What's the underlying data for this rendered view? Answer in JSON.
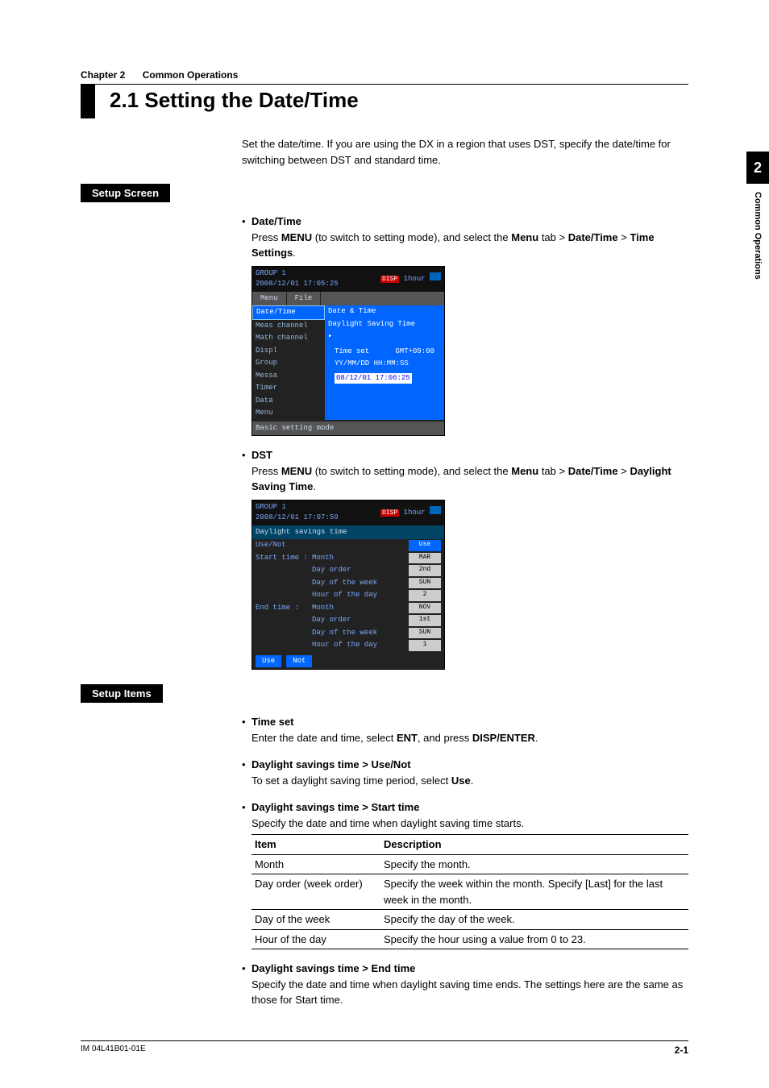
{
  "chapter": {
    "num": "Chapter 2",
    "name": "Common Operations"
  },
  "title": "2.1    Setting the Date/Time",
  "intro": "Set the date/time. If you are using the DX in a region that uses DST, specify the date/time for switching between DST and standard time.",
  "section_setup_screen": "Setup Screen",
  "datetime": {
    "head": "Date/Time",
    "line_a": "Press ",
    "menu": "MENU",
    "line_b": " (to switch to setting mode), and select the ",
    "menu2": "Menu",
    "line_c": " tab > ",
    "dt": "Date/Time",
    "line_d": " > ",
    "ts": "Time Settings",
    "period": "."
  },
  "dst": {
    "head": "DST",
    "line_a": "Press ",
    "menu": "MENU",
    "line_b": " (to switch to setting mode), and select the ",
    "menu2": "Menu",
    "line_c": " tab > ",
    "dt": "Date/Time",
    "line_d": " > ",
    "ts": "Daylight Saving Time",
    "period": "."
  },
  "ss1": {
    "group": "GROUP 1",
    "ts": "2008/12/01 17:05:25",
    "disp": "DISP",
    "hour": "1hour",
    "tab_menu": "Menu",
    "tab_file": "File",
    "l1": "Date/Time",
    "l2": "Meas channel",
    "l3": "Math channel",
    "l4": "Displ",
    "l5": "Group",
    "l6": "Messa",
    "l7": "Timer",
    "l8": "Data",
    "l9": "Menu",
    "r1": "Date & Time",
    "r2": "Daylight Saving Time",
    "p_head": "Time set",
    "p_gmt": "GMT+09:00",
    "p_fmt": "YY/MM/DD  HH:MM:SS",
    "p_val": "08/12/01 17:06:25",
    "bsm": "Basic setting mode"
  },
  "ss2": {
    "group": "GROUP 1",
    "ts": "2008/12/01 17:07:59",
    "disp": "DISP",
    "hour": "1hour",
    "title": "Daylight savings time",
    "usenot": "Use/Not",
    "use": "Use",
    "st": "Start time :",
    "et": "End time   :",
    "month": "Month",
    "dayorder": "Day order",
    "dow": "Day of the week",
    "hod": "Hour of the day",
    "v_mar": "MAR",
    "v_2nd": "2nd",
    "v_sun": "SUN",
    "v_2": "2",
    "v_nov": "NOV",
    "v_1st": "1st",
    "v_sun2": "SUN",
    "v_1": "1",
    "btn_use": "Use",
    "btn_not": "Not"
  },
  "section_setup_items": "Setup Items",
  "si_timeset": {
    "head": "Time set",
    "a": "Enter the date and time, select ",
    "ent": "ENT",
    "b": ", and press ",
    "de": "DISP/ENTER",
    "c": "."
  },
  "si_usenot": {
    "head": "Daylight savings time > Use/Not",
    "a": "To set a daylight saving time period, select ",
    "use": "Use",
    "b": "."
  },
  "si_start": {
    "head": "Daylight savings time > Start time",
    "a": "Specify the date and time when daylight saving time starts."
  },
  "table": {
    "h1": "Item",
    "h2": "Description",
    "r1c1": "Month",
    "r1c2": "Specify the month.",
    "r2c1": "Day order (week order)",
    "r2c2": "Specify the week within the month. Specify [Last] for the last week in the month.",
    "r3c1": "Day of the week",
    "r3c2": "Specify the day of the week.",
    "r4c1": "Hour of the day",
    "r4c2": "Specify the hour using a value from 0 to 23."
  },
  "si_end": {
    "head": "Daylight savings time > End time",
    "a": "Specify the date and time when daylight saving time ends. The settings here are the same as those for Start time."
  },
  "sidetab": {
    "num": "2",
    "text": "Common Operations"
  },
  "footer": {
    "left": "IM 04L41B01-01E",
    "right": "2-1"
  }
}
